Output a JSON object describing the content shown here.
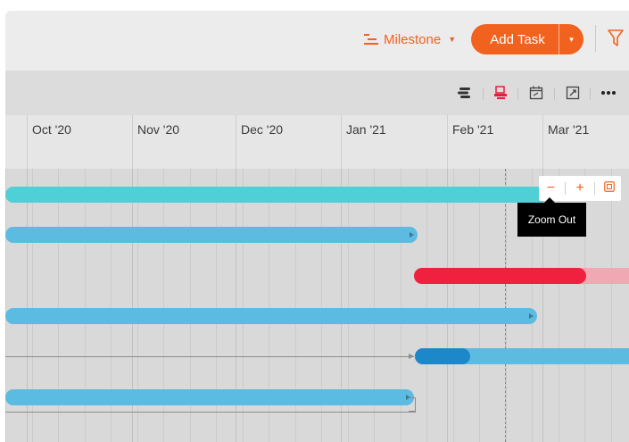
{
  "header": {
    "milestone_label": "Milestone",
    "milestone_icon": "milestone-list-icon",
    "add_task_label": "Add Task",
    "filter_icon": "filter-icon",
    "accent_color": "#f2621f"
  },
  "toolbar": {
    "icons": [
      "critical-path-icon",
      "baseline-icon",
      "calendar-icon",
      "fullscreen-icon",
      "more-icon"
    ]
  },
  "timeline": {
    "months": [
      "Oct '20",
      "Nov '20",
      "Dec '20",
      "Jan '21",
      "Feb '21",
      "Mar '21"
    ]
  },
  "zoom": {
    "minus_label": "−",
    "plus_label": "+",
    "fit_icon": "fit-to-screen-icon",
    "tooltip": "Zoom Out"
  },
  "task_colors": {
    "teal": "#4fcfd6",
    "blue": "#5bbbe0",
    "red": "#f0213f",
    "red_light": "#f0a9b2",
    "dark_blue": "#1d88c9"
  }
}
